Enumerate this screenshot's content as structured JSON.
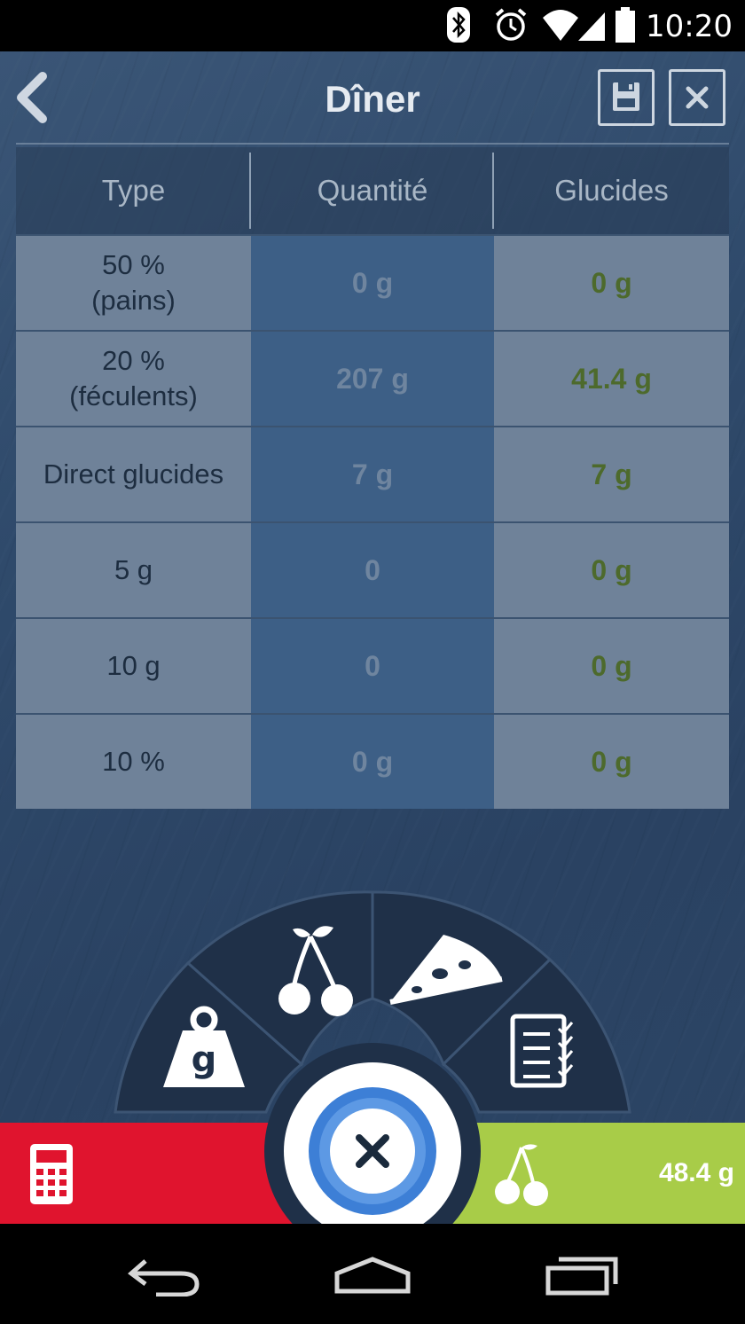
{
  "status_bar": {
    "time": "10:20"
  },
  "header": {
    "title": "Dîner"
  },
  "table": {
    "columns": [
      "Type",
      "Quantité",
      "Glucides"
    ],
    "rows": [
      {
        "type_line1": "50 %",
        "type_line2": "(pains)",
        "quantity": "0 g",
        "carbs": "0 g"
      },
      {
        "type_line1": "20 %",
        "type_line2": "(féculents)",
        "quantity": "207 g",
        "carbs": "41.4 g"
      },
      {
        "type_line1": "Direct glucides",
        "type_line2": "",
        "quantity": "7 g",
        "carbs": "7 g"
      },
      {
        "type_line1": "5 g",
        "type_line2": "",
        "quantity": "0",
        "carbs": "0 g"
      },
      {
        "type_line1": "10 g",
        "type_line2": "",
        "quantity": "0",
        "carbs": "0 g"
      },
      {
        "type_line1": "10 %",
        "type_line2": "",
        "quantity": "0 g",
        "carbs": "0 g"
      }
    ]
  },
  "radial_menu": {
    "items": [
      "weight-icon",
      "cherry-icon",
      "pizza-icon",
      "checklist-icon"
    ],
    "center": "close-icon"
  },
  "bottom_bar": {
    "total_carbs": "48.4 g",
    "left_color": "#e0142e",
    "right_color": "#a8cc48"
  }
}
